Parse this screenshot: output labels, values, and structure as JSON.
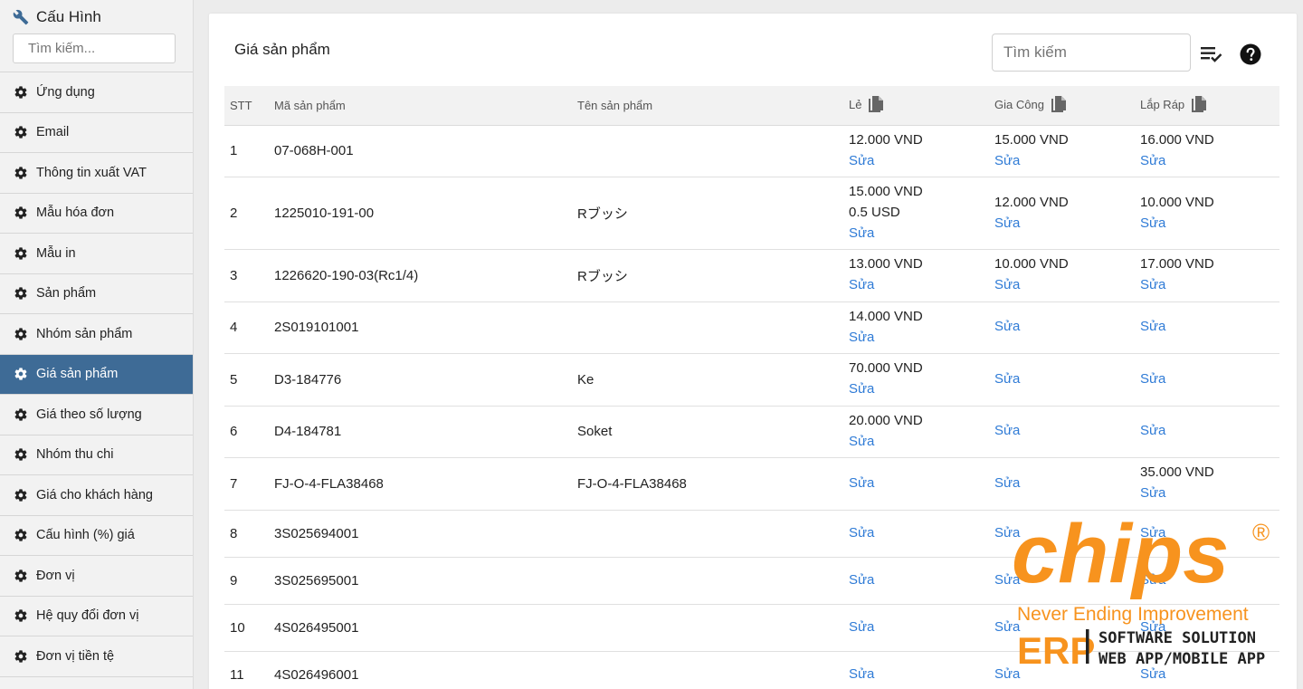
{
  "sidebar": {
    "title": "Cấu Hình",
    "search_placeholder": "Tìm kiếm...",
    "items": [
      {
        "label": "Ứng dụng"
      },
      {
        "label": "Email"
      },
      {
        "label": "Thông tin xuất VAT"
      },
      {
        "label": "Mẫu hóa đơn"
      },
      {
        "label": "Mẫu in"
      },
      {
        "label": "Sản phẩm"
      },
      {
        "label": "Nhóm sản phẩm"
      },
      {
        "label": "Giá sản phẩm"
      },
      {
        "label": "Giá theo số lượng"
      },
      {
        "label": "Nhóm thu chi"
      },
      {
        "label": "Giá cho khách hàng"
      },
      {
        "label": "Cấu hình (%) giá"
      },
      {
        "label": "Đơn vị"
      },
      {
        "label": "Hệ quy đổi đơn vị"
      },
      {
        "label": "Đơn vị tiền tệ"
      }
    ],
    "active_index": 7,
    "active_color": "#3e6b96"
  },
  "main": {
    "title": "Giá sản phẩm",
    "search_placeholder": "Tìm kiếm",
    "edit_label": "Sửa",
    "link_color": "#2f7bd6",
    "columns": [
      "STT",
      "Mã sản phẩm",
      "Tên sản phẩm",
      "Lẻ",
      "Gia Công",
      "Lắp Ráp"
    ],
    "rows": [
      {
        "stt": "1",
        "code": "07-068H-001",
        "name": "",
        "le": [
          "12.000 VND"
        ],
        "gc": [
          "15.000 VND"
        ],
        "lr": [
          "16.000 VND"
        ]
      },
      {
        "stt": "2",
        "code": "1225010-191-00",
        "name": "Rブッシ",
        "le": [
          "15.000 VND",
          "0.5 USD"
        ],
        "gc": [
          "12.000 VND"
        ],
        "lr": [
          "10.000 VND"
        ]
      },
      {
        "stt": "3",
        "code": "1226620-190-03(Rc1/4)",
        "name": "Rブッシ",
        "le": [
          "13.000 VND"
        ],
        "gc": [
          "10.000 VND"
        ],
        "lr": [
          "17.000 VND"
        ]
      },
      {
        "stt": "4",
        "code": "2S019101001",
        "name": "",
        "le": [
          "14.000 VND"
        ],
        "gc": [],
        "lr": []
      },
      {
        "stt": "5",
        "code": "D3-184776",
        "name": "Ke",
        "le": [
          "70.000 VND"
        ],
        "gc": [],
        "lr": []
      },
      {
        "stt": "6",
        "code": "D4-184781",
        "name": "Soket",
        "le": [
          "20.000 VND"
        ],
        "gc": [],
        "lr": []
      },
      {
        "stt": "7",
        "code": "FJ-O-4-FLA38468",
        "name": "FJ-O-4-FLA38468",
        "le": [],
        "gc": [],
        "lr": [
          "35.000 VND"
        ]
      },
      {
        "stt": "8",
        "code": "3S025694001",
        "name": "",
        "le": [],
        "gc": [],
        "lr": []
      },
      {
        "stt": "9",
        "code": "3S025695001",
        "name": "",
        "le": [],
        "gc": [],
        "lr": []
      },
      {
        "stt": "10",
        "code": "4S026495001",
        "name": "",
        "le": [],
        "gc": [],
        "lr": []
      },
      {
        "stt": "11",
        "code": "4S026496001",
        "name": "",
        "le": [],
        "gc": [],
        "lr": []
      }
    ]
  },
  "watermark": {
    "brand": "chips",
    "tagline": "Never Ending Improvement",
    "erp": "ERP",
    "line1": "SOFTWARE SOLUTION",
    "line2": "WEB APP/MOBILE APP",
    "registered": "®",
    "color": "#f7931e",
    "dark_color": "#222222"
  }
}
